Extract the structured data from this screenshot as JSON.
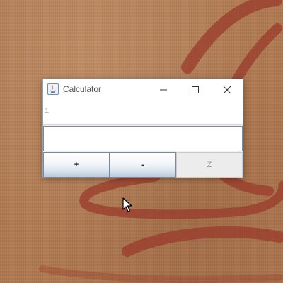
{
  "window": {
    "title": "Calculator"
  },
  "display": {
    "top_value": "1",
    "input_value": ""
  },
  "buttons": {
    "plus": "+",
    "minus": "-",
    "z": "Z"
  },
  "icons": {
    "app": "java-app-icon",
    "minimize": "minimize-icon",
    "maximize": "maximize-icon",
    "close": "close-icon",
    "cursor": "mouse-pointer-icon"
  },
  "colors": {
    "wallpaper": "#b07a52",
    "swirl": "#9a3b2c",
    "button_gradient_bottom": "#b8cbe0"
  }
}
